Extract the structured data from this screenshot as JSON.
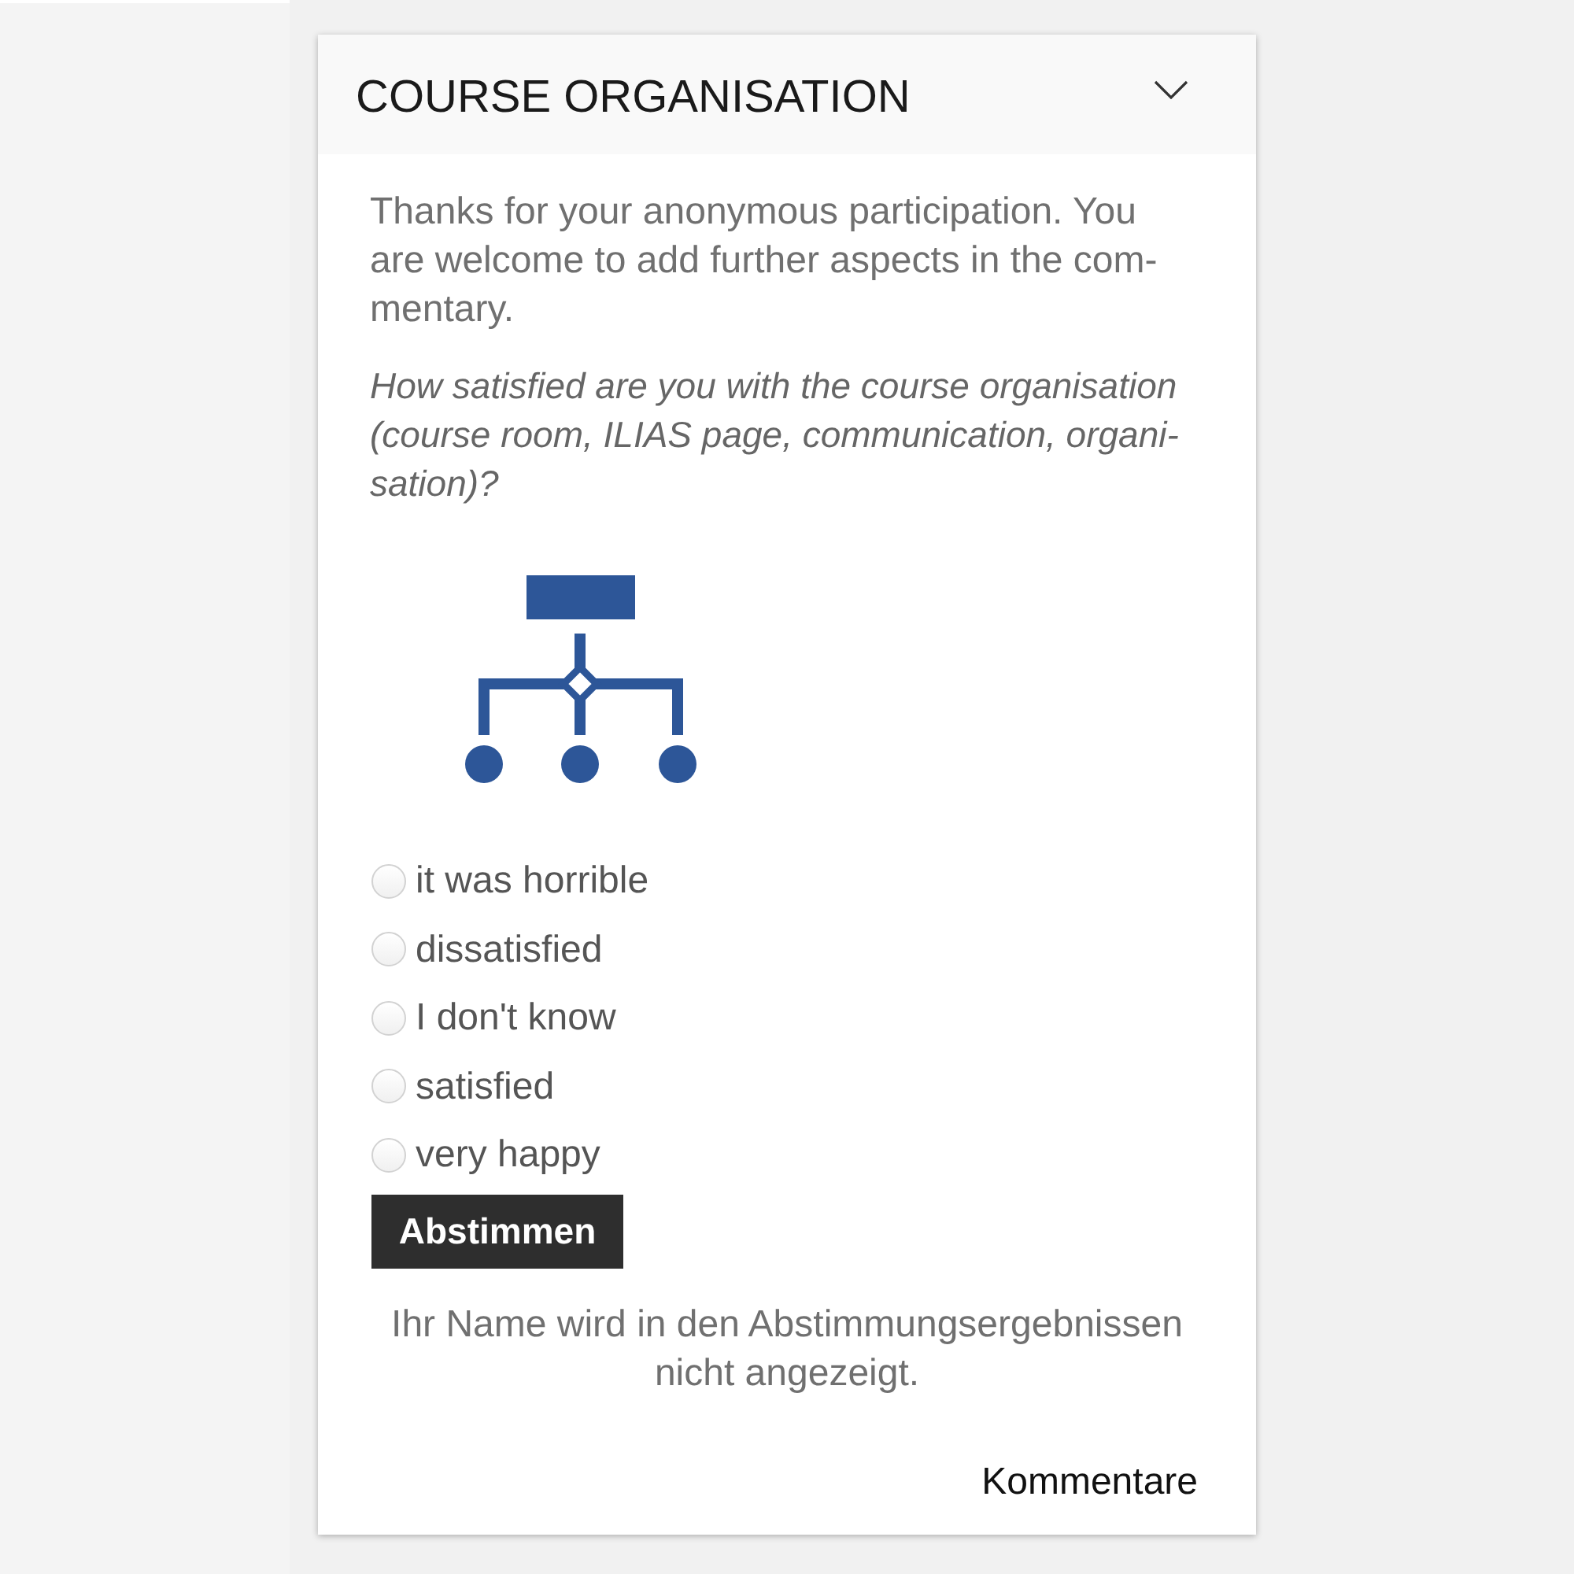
{
  "panel": {
    "title": "COURSE ORGANISATION"
  },
  "intro": "Thanks for your anonymous participation. You\nare welcome to add further aspects in the com-\nmentary.",
  "question": "How satisfied are you with the course organisation\n(course room, ILIAS page, communication, organi-\nsation)?",
  "options": [
    {
      "label": "it was horrible",
      "selected": false
    },
    {
      "label": "dissatisfied",
      "selected": false
    },
    {
      "label": "I don't know",
      "selected": false
    },
    {
      "label": "satisfied",
      "selected": false
    },
    {
      "label": "very happy",
      "selected": false
    }
  ],
  "submit_button": "Abstimmen",
  "note": "Ihr Name wird in den Abstimmungsergebnissen nicht angezeigt.",
  "comments_link": "Kommentare"
}
